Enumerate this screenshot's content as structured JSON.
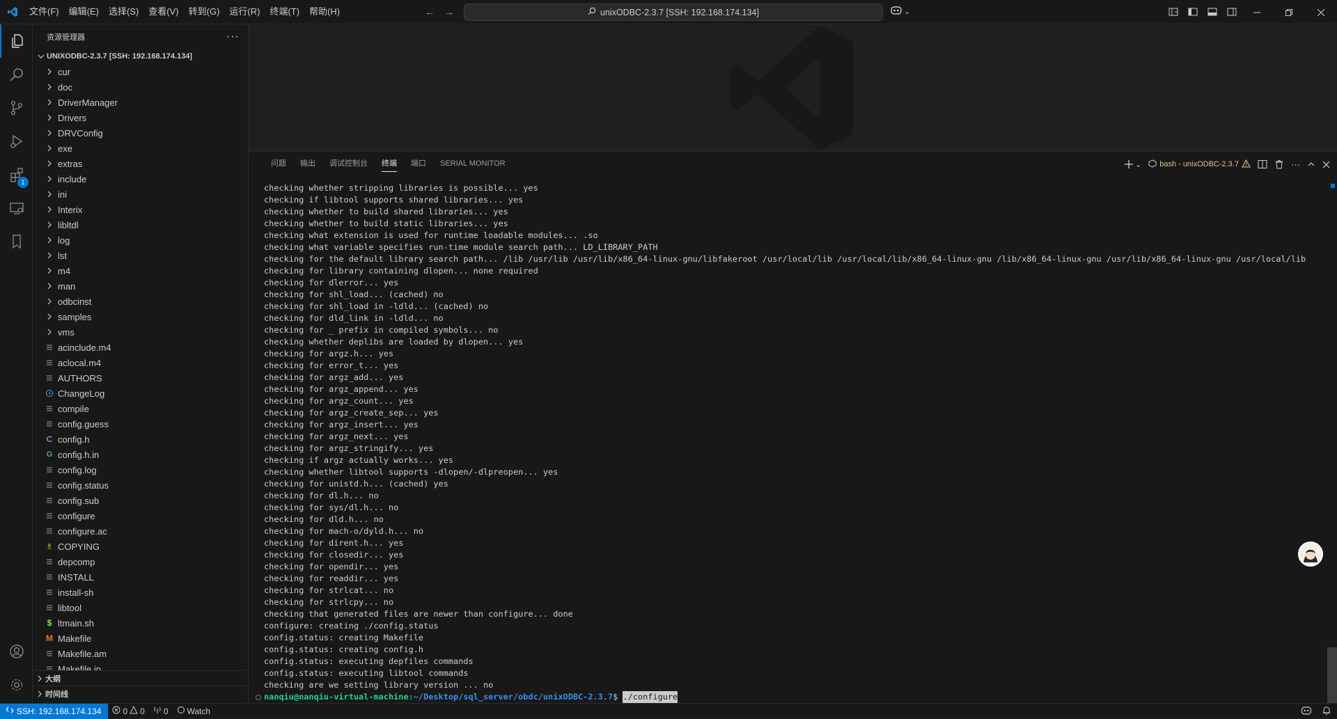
{
  "titlebar": {
    "menu": [
      "文件(F)",
      "编辑(E)",
      "选择(S)",
      "查看(V)",
      "转到(G)",
      "运行(R)",
      "终端(T)",
      "帮助(H)"
    ],
    "command_center": "unixODBC-2.3.7 [SSH: 192.168.174.134]"
  },
  "activitybar": {
    "items": [
      "explorer-icon",
      "search-icon",
      "source-control-icon",
      "run-debug-icon",
      "extensions-icon",
      "remote-explorer-icon",
      "bookmark-icon"
    ],
    "extensions_badge": "1",
    "bottom": [
      "account-icon",
      "settings-gear-icon"
    ]
  },
  "sidebar": {
    "title": "资源管理器",
    "more": "···",
    "root_folder": "UNIXODBC-2.3.7 [SSH: 192.168.174.134]",
    "items": [
      {
        "label": "cur",
        "kind": "folder"
      },
      {
        "label": "doc",
        "kind": "folder"
      },
      {
        "label": "DriverManager",
        "kind": "folder"
      },
      {
        "label": "Drivers",
        "kind": "folder"
      },
      {
        "label": "DRVConfig",
        "kind": "folder"
      },
      {
        "label": "exe",
        "kind": "folder"
      },
      {
        "label": "extras",
        "kind": "folder"
      },
      {
        "label": "include",
        "kind": "folder"
      },
      {
        "label": "ini",
        "kind": "folder"
      },
      {
        "label": "Interix",
        "kind": "folder"
      },
      {
        "label": "libltdl",
        "kind": "folder"
      },
      {
        "label": "log",
        "kind": "folder"
      },
      {
        "label": "lst",
        "kind": "folder"
      },
      {
        "label": "m4",
        "kind": "folder"
      },
      {
        "label": "man",
        "kind": "folder"
      },
      {
        "label": "odbcinst",
        "kind": "folder"
      },
      {
        "label": "samples",
        "kind": "folder"
      },
      {
        "label": "vms",
        "kind": "folder"
      },
      {
        "label": "acinclude.m4",
        "kind": "text"
      },
      {
        "label": "aclocal.m4",
        "kind": "text"
      },
      {
        "label": "AUTHORS",
        "kind": "text"
      },
      {
        "label": "ChangeLog",
        "kind": "changelog"
      },
      {
        "label": "compile",
        "kind": "text"
      },
      {
        "label": "config.guess",
        "kind": "text"
      },
      {
        "label": "config.h",
        "kind": "c"
      },
      {
        "label": "config.h.in",
        "kind": "cpp"
      },
      {
        "label": "config.log",
        "kind": "text"
      },
      {
        "label": "config.status",
        "kind": "text"
      },
      {
        "label": "config.sub",
        "kind": "text"
      },
      {
        "label": "configure",
        "kind": "text"
      },
      {
        "label": "configure.ac",
        "kind": "text"
      },
      {
        "label": "COPYING",
        "kind": "license"
      },
      {
        "label": "depcomp",
        "kind": "text"
      },
      {
        "label": "INSTALL",
        "kind": "text"
      },
      {
        "label": "install-sh",
        "kind": "text"
      },
      {
        "label": "libtool",
        "kind": "text"
      },
      {
        "label": "ltmain.sh",
        "kind": "shell"
      },
      {
        "label": "Makefile",
        "kind": "makefile"
      },
      {
        "label": "Makefile.am",
        "kind": "text"
      },
      {
        "label": "Makefile.in",
        "kind": "text"
      }
    ],
    "outline": "大纲",
    "timeline": "时间线"
  },
  "panel": {
    "tabs": [
      {
        "label": "问题",
        "active": false
      },
      {
        "label": "输出",
        "active": false
      },
      {
        "label": "调试控制台",
        "active": false
      },
      {
        "label": "终端",
        "active": true
      },
      {
        "label": "端口",
        "active": false
      },
      {
        "label": "SERIAL MONITOR",
        "active": false
      }
    ],
    "terminal_name": "bash - unixODBC-2.3.7",
    "terminal_lines": [
      "checking whether stripping libraries is possible... yes",
      "checking if libtool supports shared libraries... yes",
      "checking whether to build shared libraries... yes",
      "checking whether to build static libraries... yes",
      "checking what extension is used for runtime loadable modules... .so",
      "checking what variable specifies run-time module search path... LD_LIBRARY_PATH",
      "checking for the default library search path... /lib /usr/lib /usr/lib/x86_64-linux-gnu/libfakeroot /usr/local/lib /usr/local/lib/x86_64-linux-gnu /lib/x86_64-linux-gnu /usr/lib/x86_64-linux-gnu /usr/local/lib",
      "checking for library containing dlopen... none required",
      "checking for dlerror... yes",
      "checking for shl_load... (cached) no",
      "checking for shl_load in -ldld... (cached) no",
      "checking for dld_link in -ldld... no",
      "checking for _ prefix in compiled symbols... no",
      "checking whether deplibs are loaded by dlopen... yes",
      "checking for argz.h... yes",
      "checking for error_t... yes",
      "checking for argz_add... yes",
      "checking for argz_append... yes",
      "checking for argz_count... yes",
      "checking for argz_create_sep... yes",
      "checking for argz_insert... yes",
      "checking for argz_next... yes",
      "checking for argz_stringify... yes",
      "checking if argz actually works... yes",
      "checking whether libtool supports -dlopen/-dlpreopen... yes",
      "checking for unistd.h... (cached) yes",
      "checking for dl.h... no",
      "checking for sys/dl.h... no",
      "checking for dld.h... no",
      "checking for mach-o/dyld.h... no",
      "checking for dirent.h... yes",
      "checking for closedir... yes",
      "checking for opendir... yes",
      "checking for readdir... yes",
      "checking for strlcat... no",
      "checking for strlcpy... no",
      "checking that generated files are newer than configure... done",
      "configure: creating ./config.status",
      "config.status: creating Makefile",
      "config.status: creating config.h",
      "config.status: executing depfiles commands",
      "config.status: executing libtool commands",
      "checking are we setting library version ... no"
    ],
    "prompt": {
      "user": "nanqiu@nanqiu-virtual-machine",
      "path": ":~/Desktop/sql_server/obdc/unixODBC-2.3.7",
      "sign": "$ ",
      "command": "./configure"
    }
  },
  "statusbar": {
    "remote": "SSH: 192.168.174.134",
    "errors": "0",
    "warnings": "0",
    "ports": "0",
    "watch": "Watch"
  },
  "colors": {
    "accent": "#0078d4",
    "prompt_user": "#23d18b",
    "prompt_path": "#3b8eea",
    "warning": "#e2c08d"
  }
}
